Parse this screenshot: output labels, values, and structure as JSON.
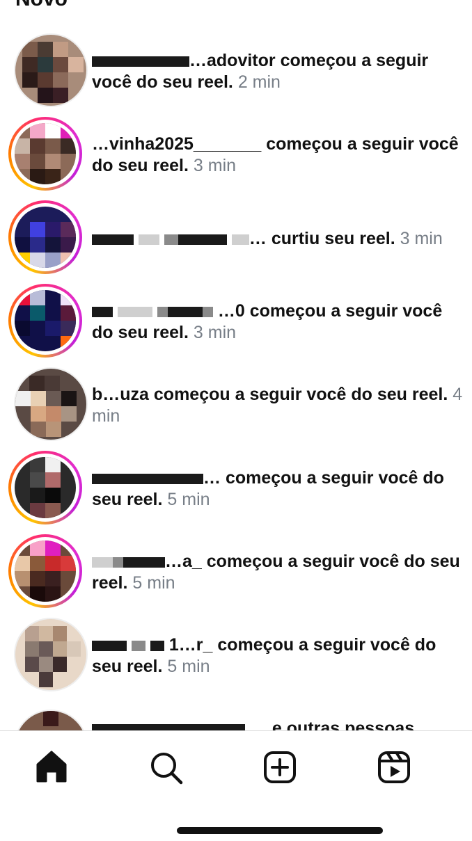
{
  "section_title": "Novo",
  "notifications": [
    {
      "username": "…adovitor",
      "action": "começou a seguir você do seu reel.",
      "time": "2 min"
    },
    {
      "username": "…vinha2025_______",
      "action": "começou a seguir você do seu reel.",
      "time": "3 min"
    },
    {
      "username": "…",
      "action": "curtiu seu reel.",
      "time": "3 min"
    },
    {
      "username": "…0",
      "action": "começou a seguir você do seu reel.",
      "time": "3 min"
    },
    {
      "username": "b…uza",
      "action": "começou a seguir você do seu reel.",
      "time": "4 min"
    },
    {
      "username": "…",
      "action": "começou a seguir você do seu reel.",
      "time": "5 min"
    },
    {
      "username": "…a_",
      "action": "começou a seguir você do seu reel.",
      "time": "5 min"
    },
    {
      "username": "1…r_",
      "action": "começou a seguir você do seu reel.",
      "time": "5 min"
    },
    {
      "username": "…",
      "action": "e outras pessoas",
      "time": ""
    }
  ],
  "tabbar": {
    "items": [
      {
        "icon": "home-icon",
        "active": true
      },
      {
        "icon": "search-icon",
        "active": false
      },
      {
        "icon": "create-post-icon",
        "active": false
      },
      {
        "icon": "reels-icon",
        "active": false
      }
    ]
  },
  "colors": {
    "text": "#111111",
    "time": "#777e87",
    "story_ring": [
      "#ffc400",
      "#ff7a00",
      "#ff2d6f",
      "#e12ccf"
    ]
  }
}
